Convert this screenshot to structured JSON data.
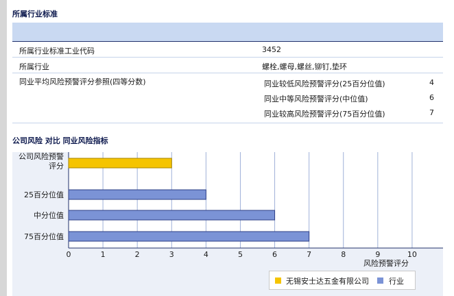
{
  "section1": {
    "title": "所属行业标准"
  },
  "rows": {
    "code": {
      "label": "所属行业标准工业代码",
      "value": "3452"
    },
    "industry": {
      "label": "所属行业",
      "value": "螺栓,螺母,螺丝,铆钉,垫环"
    },
    "avg": {
      "label": "同业平均风险预警评分参照(四等分数)",
      "items": [
        {
          "label": "同业较低风险预警评分(25百分位值)",
          "value": "4"
        },
        {
          "label": "同业中等风险预警评分(中位值)",
          "value": "6"
        },
        {
          "label": "同业较高风险预警评分(75百分位值)",
          "value": "7"
        }
      ]
    }
  },
  "section2": {
    "title": "公司风险 对比 同业风险指标"
  },
  "colors": {
    "company": "#f5c400",
    "industry": "#7b93d6",
    "header": "#c9d9f2"
  },
  "chart_data": {
    "type": "bar",
    "orientation": "horizontal",
    "categories": [
      "公司风险预警评分",
      "25百分位值",
      "中分位值",
      "75百分位值"
    ],
    "category_lines": [
      [
        "公司风险预警",
        "评分"
      ],
      [
        "25百分位值"
      ],
      [
        "中分位值"
      ],
      [
        "75百分位值"
      ]
    ],
    "series": [
      {
        "name": "无锡安士达五金有限公司",
        "colorKey": "company",
        "points": [
          {
            "category": "公司风险预警评分",
            "value": 3
          }
        ]
      },
      {
        "name": "行业",
        "colorKey": "industry",
        "points": [
          {
            "category": "25百分位值",
            "value": 4
          },
          {
            "category": "中分位值",
            "value": 6
          },
          {
            "category": "75百分位值",
            "value": 7
          }
        ]
      }
    ],
    "xlim": [
      0,
      10.9
    ],
    "xticks": [
      "0",
      "1",
      "2",
      "3",
      "4",
      "5",
      "6",
      "7",
      "8",
      "9",
      "10"
    ],
    "xlabel": "风险预警评分",
    "grid": true,
    "legend_position": "bottom-right"
  }
}
